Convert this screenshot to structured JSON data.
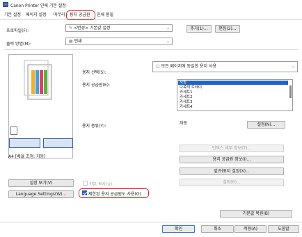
{
  "window": {
    "title": "Canon Printer 인쇄 기본 설정"
  },
  "tabs": [
    {
      "label": "기본 설정"
    },
    {
      "label": "페이지 설정"
    },
    {
      "label": "마무리"
    },
    {
      "label": "용지 공급원"
    },
    {
      "label": "인쇄 품질"
    }
  ],
  "profile": {
    "label": "프로파일(F):",
    "value": "<변경> 기본값 설정",
    "add_label": "추가(1)...",
    "edit_label": "편집(2)..."
  },
  "output": {
    "label": "출력 방법(M):",
    "value": "인쇄"
  },
  "paper_select": {
    "label": "용지 선택(S):",
    "value": "모든 페이지에 동일한 용지 사용"
  },
  "paper_source": {
    "label": "용지 공급원(E):",
    "items": [
      "자동",
      "다목적 트레이",
      "카세트1",
      "카세트2",
      "카세트3",
      "카세트4"
    ],
    "selected_index": 0
  },
  "paper_type": {
    "label": "용지 종류(Y):",
    "value": "자동",
    "settings_label": "설정(N)..."
  },
  "buttons": {
    "cover_info": "인덱스 세부 정보(T)...",
    "paper_source_info": "용지 공급원 정보(I)...",
    "front_back": "앞/뒤표지 설정(X)...",
    "settings_r": "설정(R)...",
    "view_settings": "설정 보기(V)",
    "language": "Language Settings(W)...",
    "restore_defaults": "기본값 복원(B)",
    "ok": "확인",
    "cancel": "취소",
    "apply": "적용(A)",
    "help": "도움말"
  },
  "preview": {
    "caption": "A4 [배율 조정: 자동]"
  },
  "checkboxes": {
    "copy_paper": {
      "label": "카본 복사(U):",
      "checked": false
    },
    "limit_source": {
      "label": "제한된 용지 공급원도 사용(O)",
      "checked": true
    }
  }
}
